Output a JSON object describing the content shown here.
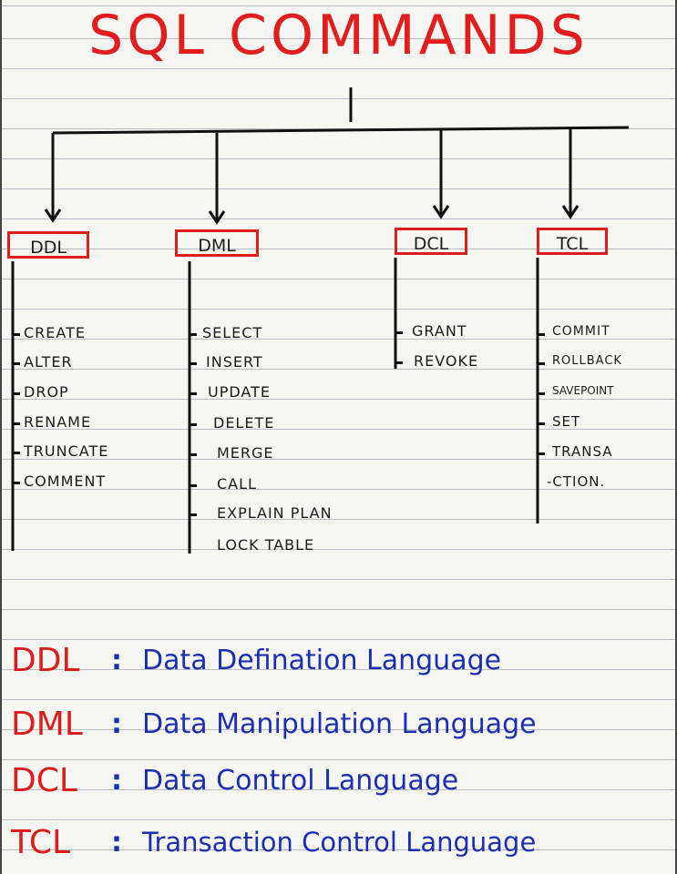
{
  "title": "SQL COMMANDS",
  "colors": {
    "title": "#e11d1d",
    "box_border": "#dd1c1c",
    "ink": "#111111",
    "legend_abbr": "#dd1c1c",
    "legend_text": "#1c2fb2",
    "paper": "#f6f6f2",
    "rule": "#b9bcc4"
  },
  "categories": [
    {
      "label": "DDL",
      "commands": [
        "CREATE",
        "ALTER",
        "DROP",
        "RENAME",
        "TRUNCATE",
        "COMMENT"
      ]
    },
    {
      "label": "DML",
      "commands": [
        "SELECT",
        "INSERT",
        "UPDATE",
        "DELETE",
        "MERGE",
        "CALL",
        "EXPLAIN PLAN",
        "LOCK TABLE"
      ]
    },
    {
      "label": "DCL",
      "commands": [
        "GRANT",
        "REVOKE"
      ]
    },
    {
      "label": "TCL",
      "commands": [
        "COMMIT",
        "ROLLBACK",
        "SAVEPOINT",
        "SET",
        "TRANSA",
        "-CTION."
      ]
    }
  ],
  "legend": [
    {
      "abbr": "DDL",
      "colon": ":",
      "text": "Data Defination Language"
    },
    {
      "abbr": "DML",
      "colon": ":",
      "text": "Data Manipulation Language"
    },
    {
      "abbr": "DCL",
      "colon": ":",
      "text": "Data Control Language"
    },
    {
      "abbr": "TCL",
      "colon": ":",
      "text": "Transaction Control Language"
    }
  ]
}
